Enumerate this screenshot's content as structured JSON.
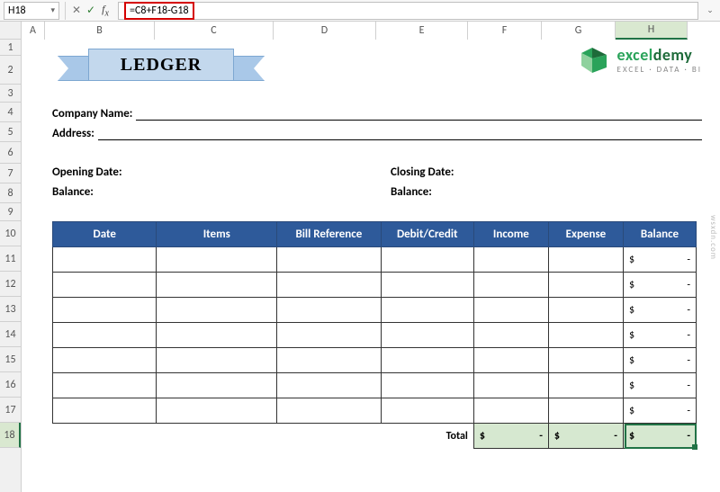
{
  "formula_bar": {
    "cell_ref": "H18",
    "formula": "=C8+F18-G18"
  },
  "columns": {
    "A": "A",
    "B": "B",
    "C": "C",
    "D": "D",
    "E": "E",
    "F": "F",
    "G": "G",
    "H": "H"
  },
  "rows": [
    "1",
    "2",
    "3",
    "4",
    "5",
    "6",
    "7",
    "8",
    "9",
    "10",
    "11",
    "12",
    "13",
    "14",
    "15",
    "16",
    "17",
    "18"
  ],
  "ribbon_title": "LEDGER",
  "brand": {
    "name_a": "excel",
    "name_b": "demy",
    "tag": "EXCEL · DATA · BI"
  },
  "labels": {
    "company": "Company Name:",
    "address": "Address:",
    "opening_date": "Opening Date:",
    "closing_date": "Closing Date:",
    "balance_open": "Balance:",
    "balance_close": "Balance:"
  },
  "headers": {
    "date": "Date",
    "items": "Items",
    "bill_ref": "Bill Reference",
    "debit_credit": "Debit/Credit",
    "income": "Income",
    "expense": "Expense",
    "balance": "Balance"
  },
  "data_rows": [
    {
      "balance": {
        "sym": "$",
        "val": "-"
      }
    },
    {
      "balance": {
        "sym": "$",
        "val": "-"
      }
    },
    {
      "balance": {
        "sym": "$",
        "val": "-"
      }
    },
    {
      "balance": {
        "sym": "$",
        "val": "-"
      }
    },
    {
      "balance": {
        "sym": "$",
        "val": "-"
      }
    },
    {
      "balance": {
        "sym": "$",
        "val": "-"
      }
    },
    {
      "balance": {
        "sym": "$",
        "val": "-"
      }
    }
  ],
  "totals": {
    "label": "Total",
    "income": {
      "sym": "$",
      "val": "-"
    },
    "expense": {
      "sym": "$",
      "val": "-"
    },
    "balance": {
      "sym": "$",
      "val": "-"
    }
  },
  "watermark": "wsxdn.com"
}
